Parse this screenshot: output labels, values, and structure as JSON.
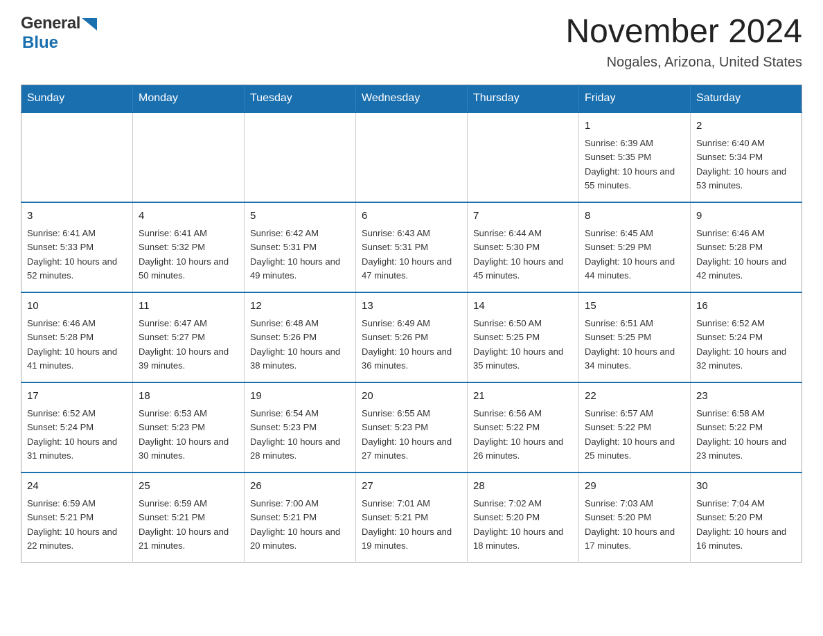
{
  "header": {
    "logo_general": "General",
    "logo_blue": "Blue",
    "title": "November 2024",
    "subtitle": "Nogales, Arizona, United States"
  },
  "days_of_week": [
    "Sunday",
    "Monday",
    "Tuesday",
    "Wednesday",
    "Thursday",
    "Friday",
    "Saturday"
  ],
  "weeks": [
    [
      {
        "day": "",
        "info": ""
      },
      {
        "day": "",
        "info": ""
      },
      {
        "day": "",
        "info": ""
      },
      {
        "day": "",
        "info": ""
      },
      {
        "day": "",
        "info": ""
      },
      {
        "day": "1",
        "info": "Sunrise: 6:39 AM\nSunset: 5:35 PM\nDaylight: 10 hours and 55 minutes."
      },
      {
        "day": "2",
        "info": "Sunrise: 6:40 AM\nSunset: 5:34 PM\nDaylight: 10 hours and 53 minutes."
      }
    ],
    [
      {
        "day": "3",
        "info": "Sunrise: 6:41 AM\nSunset: 5:33 PM\nDaylight: 10 hours and 52 minutes."
      },
      {
        "day": "4",
        "info": "Sunrise: 6:41 AM\nSunset: 5:32 PM\nDaylight: 10 hours and 50 minutes."
      },
      {
        "day": "5",
        "info": "Sunrise: 6:42 AM\nSunset: 5:31 PM\nDaylight: 10 hours and 49 minutes."
      },
      {
        "day": "6",
        "info": "Sunrise: 6:43 AM\nSunset: 5:31 PM\nDaylight: 10 hours and 47 minutes."
      },
      {
        "day": "7",
        "info": "Sunrise: 6:44 AM\nSunset: 5:30 PM\nDaylight: 10 hours and 45 minutes."
      },
      {
        "day": "8",
        "info": "Sunrise: 6:45 AM\nSunset: 5:29 PM\nDaylight: 10 hours and 44 minutes."
      },
      {
        "day": "9",
        "info": "Sunrise: 6:46 AM\nSunset: 5:28 PM\nDaylight: 10 hours and 42 minutes."
      }
    ],
    [
      {
        "day": "10",
        "info": "Sunrise: 6:46 AM\nSunset: 5:28 PM\nDaylight: 10 hours and 41 minutes."
      },
      {
        "day": "11",
        "info": "Sunrise: 6:47 AM\nSunset: 5:27 PM\nDaylight: 10 hours and 39 minutes."
      },
      {
        "day": "12",
        "info": "Sunrise: 6:48 AM\nSunset: 5:26 PM\nDaylight: 10 hours and 38 minutes."
      },
      {
        "day": "13",
        "info": "Sunrise: 6:49 AM\nSunset: 5:26 PM\nDaylight: 10 hours and 36 minutes."
      },
      {
        "day": "14",
        "info": "Sunrise: 6:50 AM\nSunset: 5:25 PM\nDaylight: 10 hours and 35 minutes."
      },
      {
        "day": "15",
        "info": "Sunrise: 6:51 AM\nSunset: 5:25 PM\nDaylight: 10 hours and 34 minutes."
      },
      {
        "day": "16",
        "info": "Sunrise: 6:52 AM\nSunset: 5:24 PM\nDaylight: 10 hours and 32 minutes."
      }
    ],
    [
      {
        "day": "17",
        "info": "Sunrise: 6:52 AM\nSunset: 5:24 PM\nDaylight: 10 hours and 31 minutes."
      },
      {
        "day": "18",
        "info": "Sunrise: 6:53 AM\nSunset: 5:23 PM\nDaylight: 10 hours and 30 minutes."
      },
      {
        "day": "19",
        "info": "Sunrise: 6:54 AM\nSunset: 5:23 PM\nDaylight: 10 hours and 28 minutes."
      },
      {
        "day": "20",
        "info": "Sunrise: 6:55 AM\nSunset: 5:23 PM\nDaylight: 10 hours and 27 minutes."
      },
      {
        "day": "21",
        "info": "Sunrise: 6:56 AM\nSunset: 5:22 PM\nDaylight: 10 hours and 26 minutes."
      },
      {
        "day": "22",
        "info": "Sunrise: 6:57 AM\nSunset: 5:22 PM\nDaylight: 10 hours and 25 minutes."
      },
      {
        "day": "23",
        "info": "Sunrise: 6:58 AM\nSunset: 5:22 PM\nDaylight: 10 hours and 23 minutes."
      }
    ],
    [
      {
        "day": "24",
        "info": "Sunrise: 6:59 AM\nSunset: 5:21 PM\nDaylight: 10 hours and 22 minutes."
      },
      {
        "day": "25",
        "info": "Sunrise: 6:59 AM\nSunset: 5:21 PM\nDaylight: 10 hours and 21 minutes."
      },
      {
        "day": "26",
        "info": "Sunrise: 7:00 AM\nSunset: 5:21 PM\nDaylight: 10 hours and 20 minutes."
      },
      {
        "day": "27",
        "info": "Sunrise: 7:01 AM\nSunset: 5:21 PM\nDaylight: 10 hours and 19 minutes."
      },
      {
        "day": "28",
        "info": "Sunrise: 7:02 AM\nSunset: 5:20 PM\nDaylight: 10 hours and 18 minutes."
      },
      {
        "day": "29",
        "info": "Sunrise: 7:03 AM\nSunset: 5:20 PM\nDaylight: 10 hours and 17 minutes."
      },
      {
        "day": "30",
        "info": "Sunrise: 7:04 AM\nSunset: 5:20 PM\nDaylight: 10 hours and 16 minutes."
      }
    ]
  ]
}
